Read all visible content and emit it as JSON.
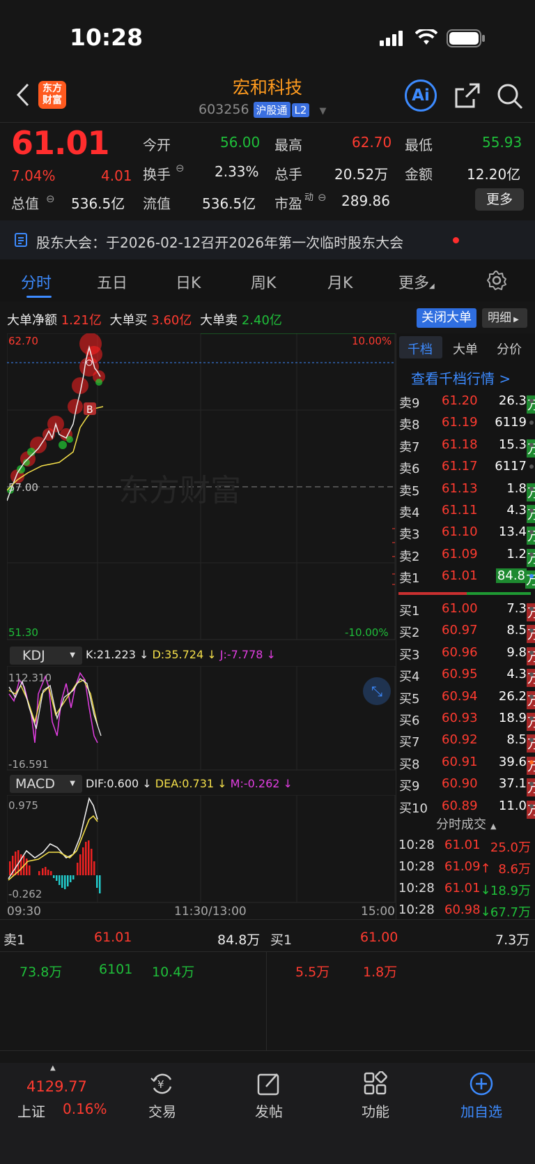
{
  "status": {
    "time": "10:28"
  },
  "header": {
    "logo_text_1": "东方",
    "logo_text_2": "财富",
    "stock_name": "宏和科技",
    "stock_code": "603256",
    "tag_hgt": "沪股通",
    "tag_l2": "L2",
    "ai_label": "Ai"
  },
  "quote": {
    "price": "61.01",
    "change_pct": "7.04%",
    "change": "4.01",
    "open_label": "今开",
    "open": "56.00",
    "high_label": "最高",
    "high": "62.70",
    "low_label": "最低",
    "low": "55.93",
    "turnover_label": "换手",
    "turnover": "2.33%",
    "volume_label": "总手",
    "volume": "20.52万",
    "amount_label": "金额",
    "amount": "12.20亿",
    "mcap_label": "总值",
    "mcap": "536.5亿",
    "float_label": "流值",
    "float": "536.5亿",
    "pe_label": "市盈",
    "pe_sup": "动",
    "pe": "289.86",
    "more_button": "更多"
  },
  "notice": {
    "text": "股东大会：于2026-02-12召开2026年第一次临时股东大会"
  },
  "tabs": [
    "分时",
    "五日",
    "日K",
    "周K",
    "月K",
    "更多"
  ],
  "bigorder": {
    "net_label": "大单净额",
    "net": "1.21亿",
    "buy_label": "大单买",
    "buy": "3.60亿",
    "sell_label": "大单卖",
    "sell": "2.40亿",
    "close_button": "关闭大单",
    "detail_button": "明细"
  },
  "chart": {
    "y_top": "62.70",
    "y_mid": "57.00",
    "y_bottom": "51.30",
    "pct_top": "10.00%",
    "pct_bottom": "-10.00%",
    "watermark": "东方财富",
    "marker": "B",
    "kdj_label": "KDJ",
    "kdj_k": "K:21.223 ↓",
    "kdj_d": "D:35.724 ↓",
    "kdj_j": "J:-7.778 ↓",
    "kdj_top": "112.310",
    "kdj_bottom": "-16.591",
    "macd_label": "MACD",
    "macd_dif": "DIF:0.600 ↓",
    "macd_dea": "DEA:0.731 ↓",
    "macd_m": "M:-0.262 ↓",
    "macd_top": "0.975",
    "macd_bottom": "-0.262",
    "t_start": "09:30",
    "t_mid": "11:30/13:00",
    "t_end": "15:00"
  },
  "orderbook": {
    "tabs": [
      "千档",
      "大单",
      "分价"
    ],
    "view_link": "查看千档行情 >",
    "asks": [
      {
        "label": "卖9",
        "price": "61.20",
        "vol": "26.3",
        "unit": "万"
      },
      {
        "label": "卖8",
        "price": "61.19",
        "vol": "6119",
        "unit": ""
      },
      {
        "label": "卖7",
        "price": "61.18",
        "vol": "15.3",
        "unit": "万"
      },
      {
        "label": "卖6",
        "price": "61.17",
        "vol": "6117",
        "unit": ""
      },
      {
        "label": "卖5",
        "price": "61.13",
        "vol": "1.8",
        "unit": "万"
      },
      {
        "label": "卖4",
        "price": "61.11",
        "vol": "4.3",
        "unit": "万"
      },
      {
        "label": "卖3",
        "price": "61.10",
        "vol": "13.4",
        "unit": "万"
      },
      {
        "label": "卖2",
        "price": "61.09",
        "vol": "1.2",
        "unit": "万"
      },
      {
        "label": "卖1",
        "price": "61.01",
        "vol": "84.8",
        "unit": "万"
      }
    ],
    "bids": [
      {
        "label": "买1",
        "price": "61.00",
        "vol": "7.3",
        "unit": "万"
      },
      {
        "label": "买2",
        "price": "60.97",
        "vol": "8.5",
        "unit": "万"
      },
      {
        "label": "买3",
        "price": "60.96",
        "vol": "9.8",
        "unit": "万"
      },
      {
        "label": "买4",
        "price": "60.95",
        "vol": "4.3",
        "unit": "万"
      },
      {
        "label": "买5",
        "price": "60.94",
        "vol": "26.2",
        "unit": "万"
      },
      {
        "label": "买6",
        "price": "60.93",
        "vol": "18.9",
        "unit": "万"
      },
      {
        "label": "买7",
        "price": "60.92",
        "vol": "8.5",
        "unit": "万"
      },
      {
        "label": "买8",
        "price": "60.91",
        "vol": "39.6",
        "unit": "万"
      },
      {
        "label": "买9",
        "price": "60.90",
        "vol": "37.1",
        "unit": "万"
      },
      {
        "label": "买10",
        "price": "60.89",
        "vol": "11.0",
        "unit": "万"
      }
    ],
    "trades_title": "分时成交",
    "trades": [
      {
        "time": "10:28",
        "price": "61.01",
        "arrow": "",
        "vol": "25.0万"
      },
      {
        "time": "10:28",
        "price": "61.09",
        "arrow": "↑",
        "vol": "8.6万"
      },
      {
        "time": "10:28",
        "price": "61.01",
        "arrow": "↓",
        "vol": "18.9万"
      },
      {
        "time": "10:28",
        "price": "60.98",
        "arrow": "↓",
        "vol": "67.7万"
      }
    ]
  },
  "queue": {
    "sell_label": "卖1",
    "sell_price": "61.01",
    "sell_vol": "84.8万",
    "buy_label": "买1",
    "buy_price": "61.00",
    "buy_vol": "7.3万",
    "sell_items": [
      "73.8万",
      "6101",
      "10.4万"
    ],
    "buy_items": [
      "5.5万",
      "1.8万"
    ]
  },
  "nav": {
    "index_value": "4129.77",
    "index_name": "上证",
    "index_pct": "0.16%",
    "trade": "交易",
    "post": "发帖",
    "func": "功能",
    "add": "加自选"
  }
}
